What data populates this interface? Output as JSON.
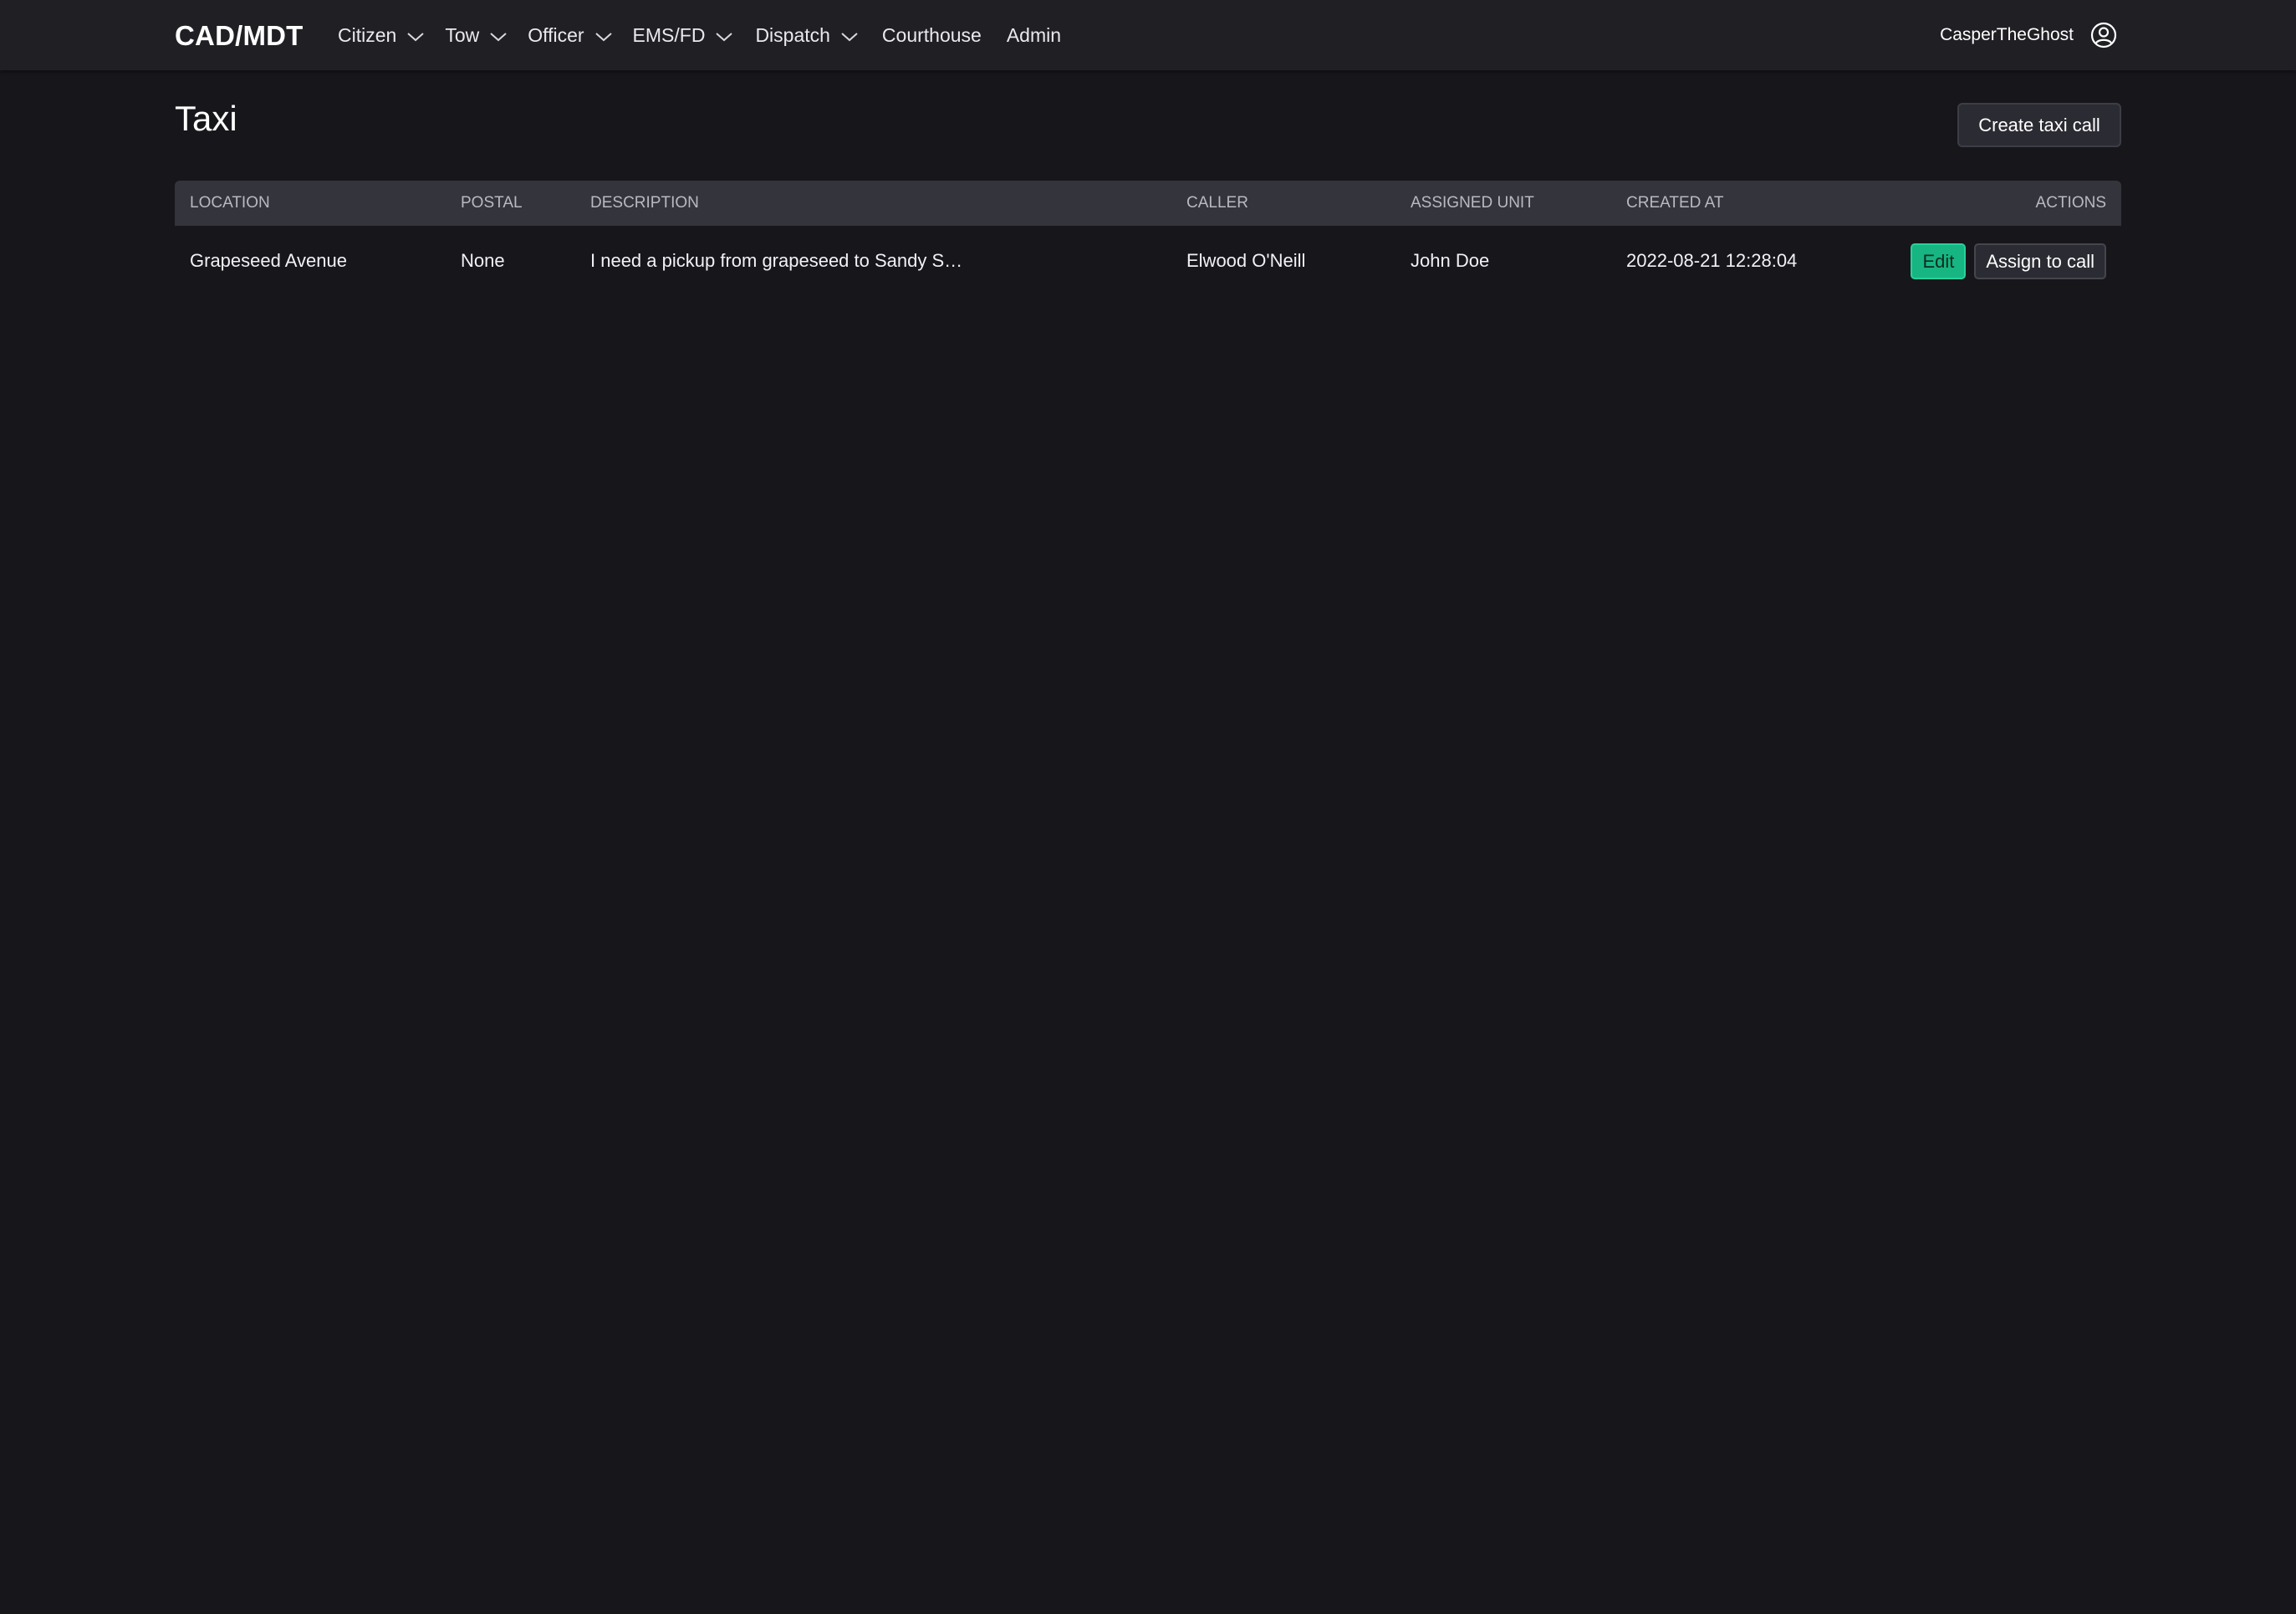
{
  "navbar": {
    "brand": "CAD/MDT",
    "items": [
      {
        "label": "Citizen",
        "dropdown": true
      },
      {
        "label": "Tow",
        "dropdown": true
      },
      {
        "label": "Officer",
        "dropdown": true
      },
      {
        "label": "EMS/FD",
        "dropdown": true
      },
      {
        "label": "Dispatch",
        "dropdown": true
      },
      {
        "label": "Courthouse",
        "dropdown": false
      },
      {
        "label": "Admin",
        "dropdown": false
      }
    ],
    "username": "CasperTheGhost",
    "user_icon": "user-circle-icon"
  },
  "page": {
    "title": "Taxi",
    "create_button": "Create taxi call"
  },
  "table": {
    "headers": {
      "location": "Location",
      "postal": "Postal",
      "description": "Description",
      "caller": "Caller",
      "assigned_unit": "Assigned Unit",
      "created_at": "Created At",
      "actions": "Actions"
    },
    "rows": [
      {
        "location": "Grapeseed Avenue",
        "postal": "None",
        "description": "I need a pickup from grapeseed to Sandy S…",
        "caller": "Elwood O'Neill",
        "assigned_unit": "John Doe",
        "created_at": "2022-08-21 12:28:04",
        "edit_label": "Edit",
        "assign_label": "Assign to call"
      }
    ]
  },
  "colors": {
    "background": "#16161b",
    "navbar": "#1f1f24",
    "table_header": "#34343c",
    "accent_green": "#17b581"
  }
}
